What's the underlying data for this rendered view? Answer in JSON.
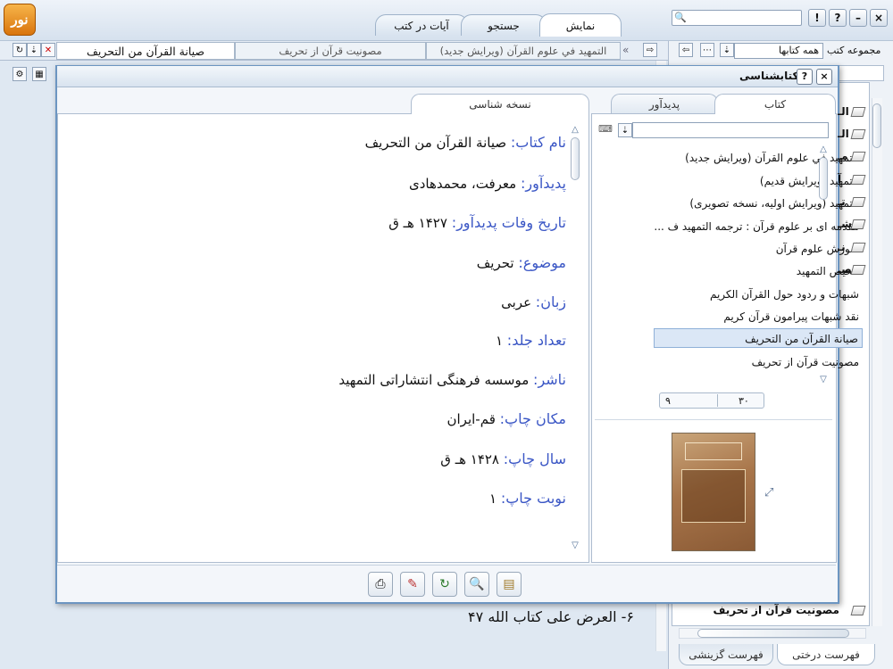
{
  "top_tabs": [
    {
      "label": "نمایش",
      "active": true
    },
    {
      "label": "جستجو",
      "active": false
    },
    {
      "label": "آیات در کتب",
      "active": false
    }
  ],
  "window_buttons": {
    "help": "?",
    "exclaim": "!",
    "minimize": "–",
    "close": "×"
  },
  "logo_text": "نور",
  "doc_tabs": [
    {
      "label": "صيانة القرآن من التحريف",
      "active": true
    },
    {
      "label": "مصونیت قرآن از تحریف",
      "active": false
    },
    {
      "label": "التمهيد في علوم القرآن (ويرايش جديد)",
      "active": false
    }
  ],
  "collection": {
    "label": "مجموعه کتب",
    "select_value": "همه کتابها"
  },
  "dialog": {
    "title": "کتابشناسی",
    "left_tab": "نسخه شناسی",
    "right_tabs": [
      {
        "label": "کتاب",
        "active": true
      },
      {
        "label": "پدیدآور",
        "active": false
      }
    ],
    "fields": [
      {
        "label": "نام کتاب:",
        "value": "صيانة القرآن من التحريف"
      },
      {
        "label": "پدیدآور:",
        "value": "معرفت، محمدهادی"
      },
      {
        "label": "تاریخ وفات پدیدآور:",
        "value": "۱۴۲۷ هـ ق"
      },
      {
        "label": "موضوع:",
        "value": "تحریف"
      },
      {
        "label": "زبان:",
        "value": "عربی"
      },
      {
        "label": "تعداد جلد:",
        "value": "۱"
      },
      {
        "label": "ناشر:",
        "value": "موسسه فرهنگی انتشاراتی التمهید"
      },
      {
        "label": "مکان چاپ:",
        "value": "قم-ایران"
      },
      {
        "label": "سال چاپ:",
        "value": "۱۴۲۸ هـ ق"
      },
      {
        "label": "نوبت چاپ:",
        "value": "۱"
      }
    ],
    "book_list": [
      {
        "label": "التمهيد في علوم القرآن (ويرايش جديد)",
        "selected": false
      },
      {
        "label": "التمهيد (ويرايش قديم)",
        "selected": false
      },
      {
        "label": "التمهيد (ويرايش اوليه، نسخه تصويری)",
        "selected": false
      },
      {
        "label": "مقدمه ای بر علوم قرآن : ترجمه التمهيد ف ...",
        "selected": false
      },
      {
        "label": "آموزش علوم قرآن",
        "selected": false
      },
      {
        "label": "تلخيص التمهيد",
        "selected": false
      },
      {
        "label": "شبهات و ردود حول القرآن الكريم",
        "selected": false
      },
      {
        "label": "نقد شبهات پيرامون قرآن كريم",
        "selected": false
      },
      {
        "label": "صيانة القرآن من التحريف",
        "selected": true
      },
      {
        "label": "مصونيت قرآن از تحريف",
        "selected": false
      }
    ],
    "pager": {
      "total": "۳۰",
      "current": "۹"
    }
  },
  "background_text": "۶- العرض على كتاب الله ۴۷",
  "tree_bottom_item": "مصونيت قرآن از تحريف",
  "bottom_tabs": [
    {
      "label": "فهرست درختی",
      "active": true
    },
    {
      "label": "فهرست گزینشی",
      "active": false
    }
  ],
  "tree_fragments": [
    "الـ",
    "الـ",
    "مـ",
    "آ",
    "تـ",
    "شـ",
    "نـ",
    "صـ"
  ]
}
